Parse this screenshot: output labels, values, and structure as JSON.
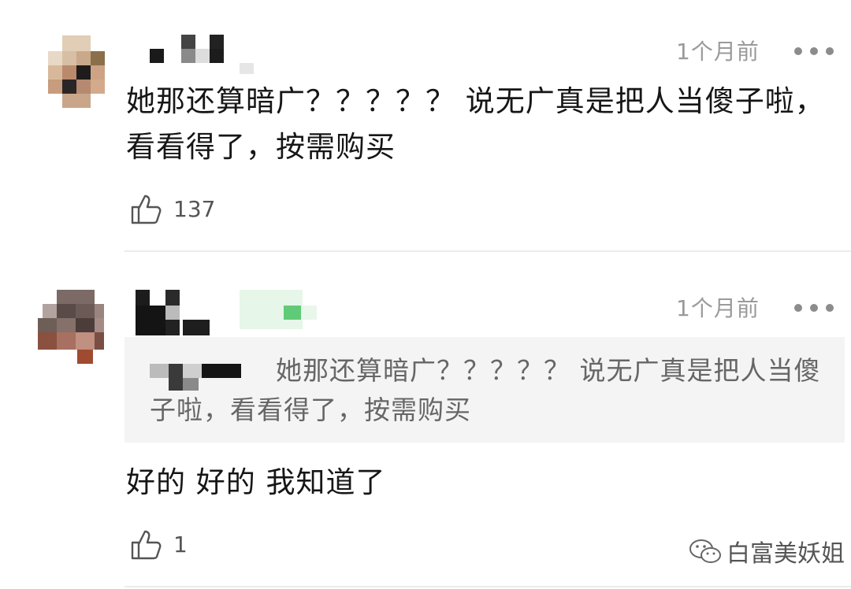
{
  "comments": [
    {
      "time": "1个月前",
      "text": "她那还算暗广？？？？？ 说无广真是把人当傻子啦，看看得了，按需购买",
      "likes": "137"
    },
    {
      "time": "1个月前",
      "quoted_text": "她那还算暗广？？？？？ 说无广真是把人当傻子啦，看看得了，按需购买",
      "text": "好的 好的 我知道了",
      "likes": "1"
    }
  ],
  "icons": {
    "more": "more-dots-icon",
    "like": "thumbs-up-icon",
    "watermark": "wechat-icon"
  },
  "watermark": {
    "text": "白富美妖姐"
  },
  "colors": {
    "time": "#9a9a9a",
    "quote_bg": "#f4f4f4",
    "highlight": "#5fcb78"
  }
}
